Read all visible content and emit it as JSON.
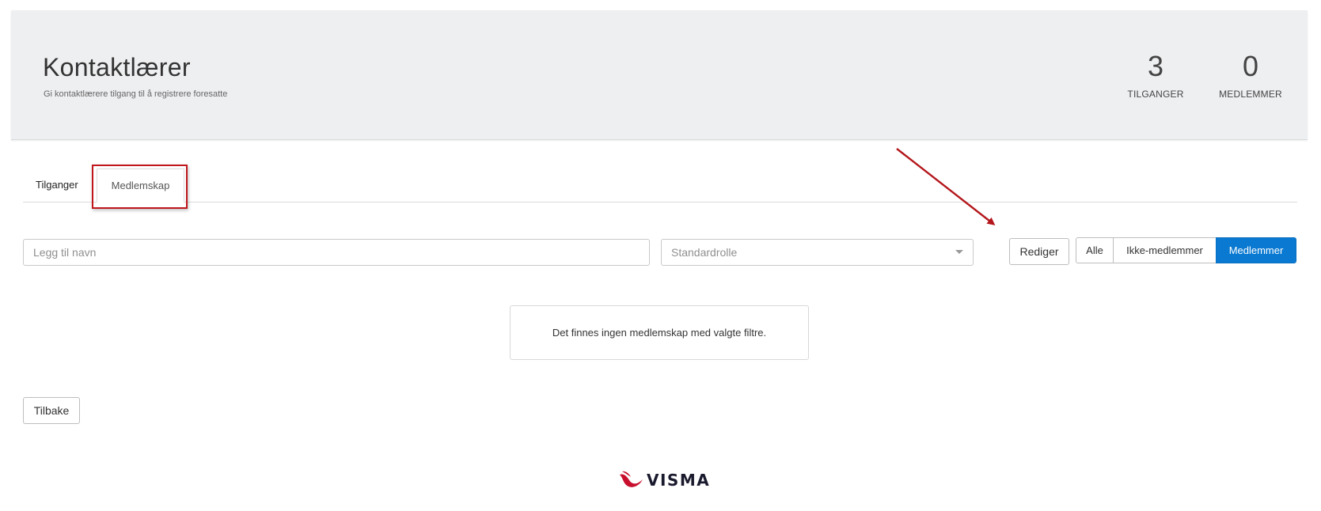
{
  "header": {
    "title": "Kontaktlærer",
    "subtitle": "Gi kontaktlærere tilgang til å registrere foresatte",
    "stats": [
      {
        "value": "3",
        "label": "TILGANGER"
      },
      {
        "value": "0",
        "label": "MEDLEMMER"
      }
    ]
  },
  "tabs": [
    {
      "label": "Tilganger",
      "active": false
    },
    {
      "label": "Medlemskap",
      "active": true
    }
  ],
  "filters": {
    "name_placeholder": "Legg til navn",
    "role_select_value": "Standardrolle",
    "edit_label": "Rediger",
    "segments": [
      {
        "label": "Alle",
        "active": false
      },
      {
        "label": "Ikke-medlemmer",
        "active": false
      },
      {
        "label": "Medlemmer",
        "active": true
      }
    ]
  },
  "empty_message": "Det finnes ingen medlemskap med valgte filtre.",
  "back_label": "Tilbake",
  "logo": {
    "text": "VISMA"
  },
  "colors": {
    "accent": "#0a79d1",
    "annotation": "#c0161c",
    "header_bg": "#eeeff1",
    "logo_swoosh": "#c8102e"
  }
}
